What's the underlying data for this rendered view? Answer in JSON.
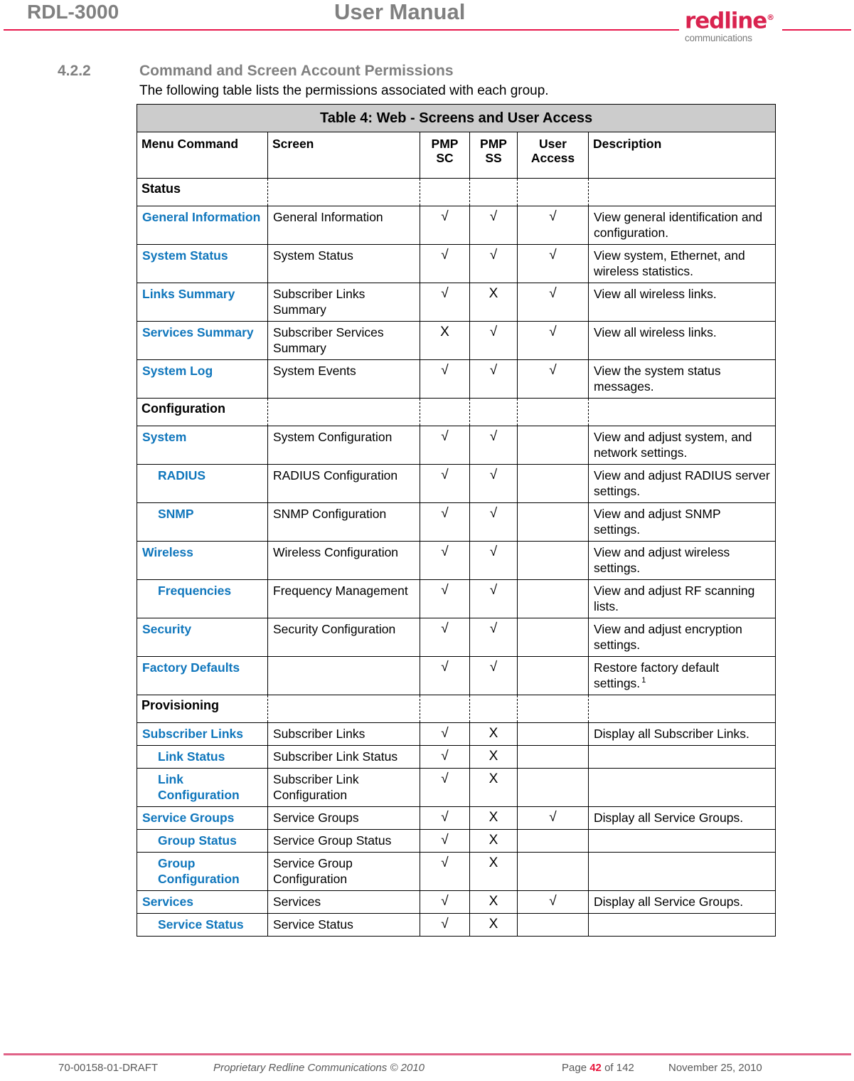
{
  "header": {
    "doc_title": "RDL-3000",
    "manual_title": "User Manual",
    "logo": {
      "word": "redline",
      "registered": "®",
      "subtitle": "communications"
    },
    "rule_color": "#E8164B"
  },
  "section": {
    "number": "4.2.2",
    "title": "Command and Screen Account Permissions",
    "intro": "The following table lists the permissions associated with each group."
  },
  "table": {
    "caption": "Table 4: Web - Screens and User Access",
    "columns": [
      "Menu Command",
      "Screen",
      "PMP SC",
      "PMP SS",
      "User Access",
      "Description"
    ],
    "column_labels": {
      "menu": "Menu Command",
      "screen": "Screen",
      "pmp_sc_l1": "PMP",
      "pmp_sc_l2": "SC",
      "pmp_ss_l1": "PMP",
      "pmp_ss_l2": "SS",
      "user_access_l1": "User",
      "user_access_l2": "Access",
      "description": "Description"
    },
    "groups": [
      {
        "label": "Status",
        "rows": [
          {
            "menu": "General Information",
            "indent": false,
            "screen": "General Information",
            "pmp_sc": "√",
            "pmp_ss": "√",
            "user_access": "√",
            "description": "View general identification and configuration."
          },
          {
            "menu": "System Status",
            "indent": false,
            "screen": "System Status",
            "pmp_sc": "√",
            "pmp_ss": "√",
            "user_access": "√",
            "description": "View system, Ethernet, and wireless statistics."
          },
          {
            "menu": "Links Summary",
            "indent": false,
            "screen": "Subscriber Links Summary",
            "pmp_sc": "√",
            "pmp_ss": "X",
            "user_access": "√",
            "description": "View all wireless links."
          },
          {
            "menu": "Services Summary",
            "indent": false,
            "screen": "Subscriber Services Summary",
            "pmp_sc": "X",
            "pmp_ss": "√",
            "user_access": "√",
            "description": "View all wireless links."
          },
          {
            "menu": "System Log",
            "indent": false,
            "screen": "System Events",
            "pmp_sc": "√",
            "pmp_ss": "√",
            "user_access": "√",
            "description": "View the system status messages."
          }
        ]
      },
      {
        "label": "Configuration",
        "rows": [
          {
            "menu": "System",
            "indent": false,
            "screen": "System Configuration",
            "pmp_sc": "√",
            "pmp_ss": "√",
            "user_access": "",
            "description": "View and adjust system, and network settings."
          },
          {
            "menu": "RADIUS",
            "indent": true,
            "screen": "RADIUS Configuration",
            "pmp_sc": "√",
            "pmp_ss": "√",
            "user_access": "",
            "description": "View and adjust RADIUS server settings."
          },
          {
            "menu": "SNMP",
            "indent": true,
            "screen": "SNMP Configuration",
            "pmp_sc": "√",
            "pmp_ss": "√",
            "user_access": "",
            "description": "View and adjust SNMP settings."
          },
          {
            "menu": "Wireless",
            "indent": false,
            "screen": "Wireless Configuration",
            "pmp_sc": "√",
            "pmp_ss": "√",
            "user_access": "",
            "description": "View and adjust wireless settings."
          },
          {
            "menu": "Frequencies",
            "indent": true,
            "screen": "Frequency Management",
            "pmp_sc": "√",
            "pmp_ss": "√",
            "user_access": "",
            "description": "View and adjust RF scanning lists."
          },
          {
            "menu": "Security",
            "indent": false,
            "screen": "Security Configuration",
            "pmp_sc": "√",
            "pmp_ss": "√",
            "user_access": "",
            "description": "View and adjust encryption settings."
          },
          {
            "menu": "Factory Defaults",
            "indent": false,
            "screen": "",
            "pmp_sc": "√",
            "pmp_ss": "√",
            "user_access": "",
            "description": "Restore factory default settings.",
            "description_footnote": "1"
          }
        ]
      },
      {
        "label": "Provisioning",
        "rows": [
          {
            "menu": "Subscriber Links",
            "indent": false,
            "screen": "Subscriber Links",
            "pmp_sc": "√",
            "pmp_ss": "X",
            "user_access": "",
            "description": "Display all Subscriber Links."
          },
          {
            "menu": "Link Status",
            "indent": true,
            "screen": "Subscriber Link Status",
            "pmp_sc": "√",
            "pmp_ss": "X",
            "user_access": "",
            "description": ""
          },
          {
            "menu": "Link Configuration",
            "indent": true,
            "screen": "Subscriber Link Configuration",
            "pmp_sc": "√",
            "pmp_ss": "X",
            "user_access": "",
            "description": ""
          },
          {
            "menu": "Service Groups",
            "indent": false,
            "screen": "Service Groups",
            "pmp_sc": "√",
            "pmp_ss": "X",
            "user_access": "√",
            "description": "Display all Service Groups."
          },
          {
            "menu": "Group Status",
            "indent": true,
            "screen": "Service Group Status",
            "pmp_sc": "√",
            "pmp_ss": "X",
            "user_access": "",
            "description": ""
          },
          {
            "menu": "Group Configuration",
            "indent": true,
            "screen": "Service Group Configuration",
            "pmp_sc": "√",
            "pmp_ss": "X",
            "user_access": "",
            "description": ""
          },
          {
            "menu": "Services",
            "indent": false,
            "screen": "Services",
            "pmp_sc": "√",
            "pmp_ss": "X",
            "user_access": "√",
            "description": "Display all Service Groups."
          },
          {
            "menu": "Service Status",
            "indent": true,
            "screen": "Service Status",
            "pmp_sc": "√",
            "pmp_ss": "X",
            "user_access": "",
            "description": ""
          }
        ]
      }
    ]
  },
  "footer": {
    "doc_number": "70-00158-01-DRAFT",
    "proprietary": "Proprietary Redline Communications © 2010",
    "page_prefix": "Page",
    "page_number": "42",
    "page_suffix": "of 142",
    "date": "November 25, 2010",
    "rule_color": "#E06287",
    "page_number_color": "#E8163C"
  },
  "colors": {
    "link_blue": "#0F76BC",
    "heading_gray": "#808080",
    "caption_bg": "#CCCCCC"
  }
}
